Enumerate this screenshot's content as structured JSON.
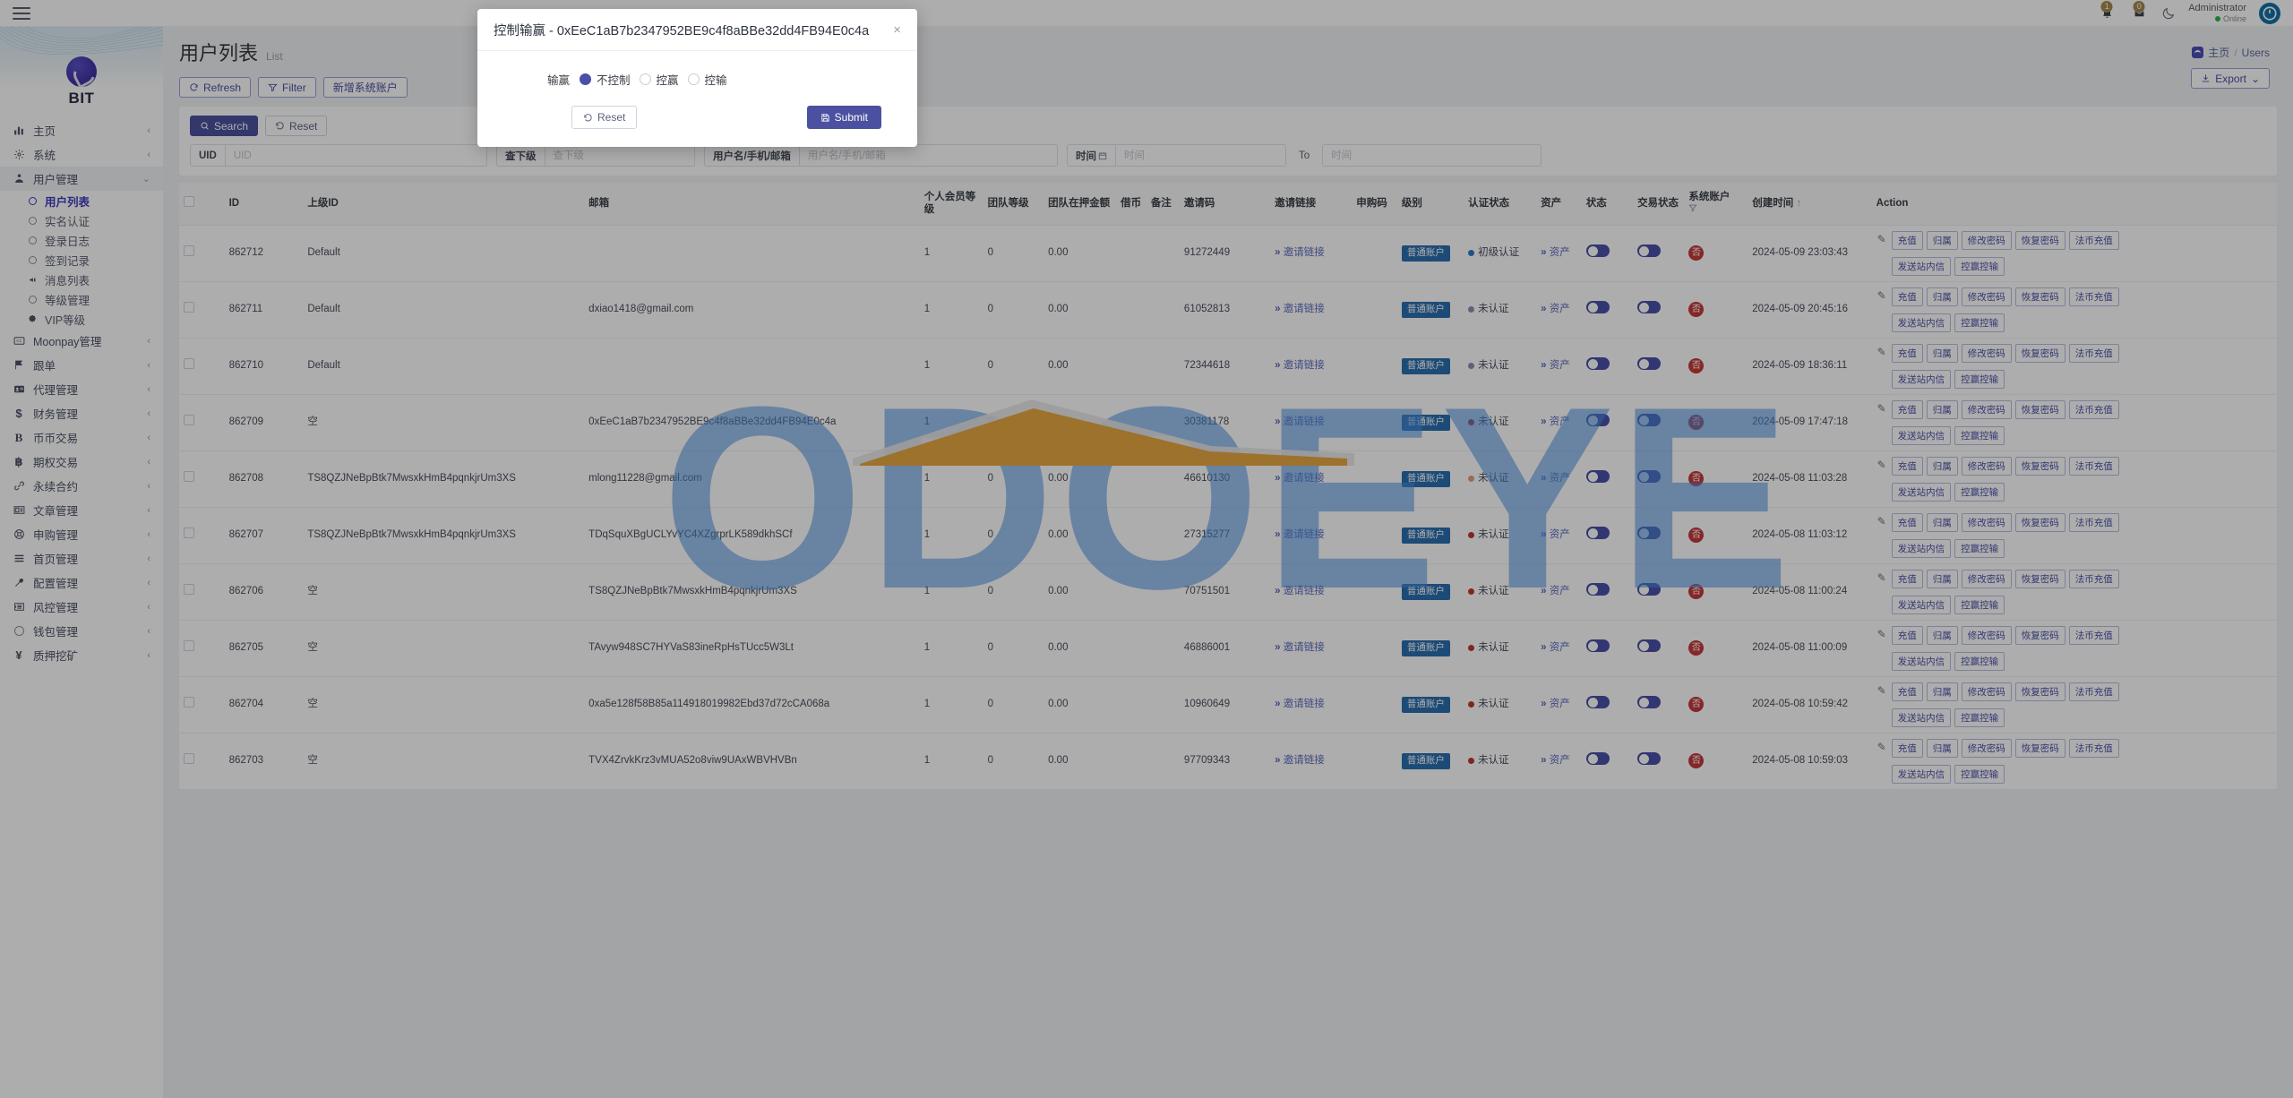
{
  "topbar": {
    "menu_icon": "hamburger-icon",
    "notification_count": "1",
    "message_count": "0",
    "theme_icon": "moon-icon",
    "user_name": "Administrator",
    "user_status": "Online",
    "avatar_icon": "power-icon"
  },
  "sidebar": {
    "brand": "BIT",
    "items": [
      {
        "label": "主页",
        "icon": "chart-icon",
        "arrow": "‹"
      },
      {
        "label": "系统",
        "icon": "gear-icon",
        "arrow": "‹"
      },
      {
        "label": "用户管理",
        "icon": "users-icon",
        "arrow": "⌄",
        "active": true
      }
    ],
    "sub_items": [
      {
        "label": "用户列表",
        "icon": "ring-icon",
        "current": true
      },
      {
        "label": "实名认证",
        "icon": "ring-icon"
      },
      {
        "label": "登录日志",
        "icon": "ring-icon"
      },
      {
        "label": "签到记录",
        "icon": "ring-icon"
      },
      {
        "label": "消息列表",
        "icon": "megaphone-icon"
      },
      {
        "label": "等级管理",
        "icon": "ring-icon"
      },
      {
        "label": "VIP等级",
        "icon": "gear-icon"
      }
    ],
    "items_after": [
      {
        "label": "Moonpay管理",
        "icon": "credit-card-icon",
        "arrow": "‹"
      },
      {
        "label": "跟单",
        "icon": "flag-icon",
        "arrow": "‹"
      },
      {
        "label": "代理管理",
        "icon": "id-card-icon",
        "arrow": "‹"
      },
      {
        "label": "财务管理",
        "icon": "dollar-icon",
        "arrow": "‹"
      },
      {
        "label": "币币交易",
        "icon": "bold-b-icon",
        "arrow": "‹"
      },
      {
        "label": "期权交易",
        "icon": "bitcoin-icon",
        "arrow": "‹"
      },
      {
        "label": "永续合约",
        "icon": "link-icon",
        "arrow": "‹"
      },
      {
        "label": "文章管理",
        "icon": "newspaper-icon",
        "arrow": "‹"
      },
      {
        "label": "申购管理",
        "icon": "lifebuoy-icon",
        "arrow": "‹"
      },
      {
        "label": "首页管理",
        "icon": "list-icon",
        "arrow": "‹"
      },
      {
        "label": "配置管理",
        "icon": "wrench-icon",
        "arrow": "‹"
      },
      {
        "label": "风控管理",
        "icon": "shield-list-icon",
        "arrow": "‹"
      },
      {
        "label": "钱包管理",
        "icon": "ring-icon",
        "arrow": "‹"
      },
      {
        "label": "质押挖矿",
        "icon": "yen-icon",
        "arrow": "‹"
      }
    ]
  },
  "breadcrumb": {
    "home": "主页",
    "sep": "/",
    "current": "Users"
  },
  "page": {
    "title": "用户列表",
    "subtitle": "List",
    "export_label": "Export",
    "export_caret": "⌄"
  },
  "toolbar": {
    "refresh": "Refresh",
    "filter": "Filter",
    "add_system_account": "新增系统账户"
  },
  "search": {
    "search_label": "Search",
    "reset_label": "Reset",
    "fields": [
      {
        "label": "UID",
        "value": "",
        "placeholder": "UID"
      },
      {
        "label": "查下级",
        "value": "",
        "placeholder": "查下级"
      },
      {
        "label": "用户名/手机/邮箱",
        "value": "",
        "placeholder": "用户名/手机/邮箱"
      },
      {
        "label": "时间",
        "value": "",
        "placeholder": "时间"
      }
    ],
    "to_word": "To",
    "time_end_placeholder": "时间"
  },
  "table": {
    "headers": [
      "",
      "ID",
      "上级ID",
      "邮箱",
      "个人会员等级",
      "团队等级",
      "团队在押金额",
      "借币",
      "备注",
      "邀请码",
      "邀请链接",
      "申购码",
      "级别",
      "认证状态",
      "资产",
      "状态",
      "交易状态",
      "系统账户",
      "创建时间",
      "Action"
    ],
    "sort_arrow": "↑",
    "filter_icon": "filter-icon",
    "invite_link_text": "邀请链接",
    "asset_text": "资产",
    "account_tag": "普通账户",
    "no_badge": "否",
    "action_pencil": "pencil-icon",
    "action_buttons_row1": [
      "充值",
      "归属",
      "修改密码",
      "恢复密码",
      "法币充值"
    ],
    "action_buttons_row2": [
      "发送站内信",
      "控赢控输"
    ],
    "rows": [
      {
        "id": "862712",
        "parent": "Default",
        "email": "",
        "member_level": "1",
        "team_level": "0",
        "team_amount": "0.00",
        "coin": "",
        "note": "",
        "invite_code": "91272449",
        "sub_code": "",
        "grade": "",
        "cert": "初级认证",
        "cert_color": "#2b7cc4",
        "created": "2024-05-09 23:03:43"
      },
      {
        "id": "862711",
        "parent": "Default",
        "email": "dxiao1418@gmail.com",
        "member_level": "1",
        "team_level": "0",
        "team_amount": "0.00",
        "coin": "",
        "note": "",
        "invite_code": "61052813",
        "sub_code": "",
        "grade": "",
        "cert": "未认证",
        "cert_color": "#8d8fb5",
        "created": "2024-05-09 20:45:16"
      },
      {
        "id": "862710",
        "parent": "Default",
        "email": "",
        "member_level": "1",
        "team_level": "0",
        "team_amount": "0.00",
        "coin": "",
        "note": "",
        "invite_code": "72344618",
        "sub_code": "",
        "grade": "",
        "cert": "未认证",
        "cert_color": "#8d8fb5",
        "created": "2024-05-09 18:36:11"
      },
      {
        "id": "862709",
        "parent": "空",
        "email": "0xEeC1aB7b2347952BE9c4f8aBBe32dd4FB94E0c4a",
        "member_level": "1",
        "team_level": "0",
        "team_amount": "0.00",
        "coin": "",
        "note": "",
        "invite_code": "30381178",
        "sub_code": "",
        "grade": "",
        "cert": "未认证",
        "cert_color": "#c0392b",
        "created": "2024-05-09 17:47:18"
      },
      {
        "id": "862708",
        "parent": "TS8QZJNeBpBtk7MwsxkHmB4pqnkjrUm3XS",
        "email": "mlong11228@gmail.com",
        "member_level": "1",
        "team_level": "0",
        "team_amount": "0.00",
        "coin": "",
        "note": "",
        "invite_code": "46610130",
        "sub_code": "",
        "grade": "",
        "cert": "未认证",
        "cert_color": "#e2a07a",
        "created": "2024-05-08 11:03:28"
      },
      {
        "id": "862707",
        "parent": "TS8QZJNeBpBtk7MwsxkHmB4pqnkjrUm3XS",
        "email": "TDqSquXBgUCLYvYC4XZgrprLK589dkhSCf",
        "member_level": "1",
        "team_level": "0",
        "team_amount": "0.00",
        "coin": "",
        "note": "",
        "invite_code": "27315277",
        "sub_code": "",
        "grade": "",
        "cert": "未认证",
        "cert_color": "#c0392b",
        "created": "2024-05-08 11:03:12"
      },
      {
        "id": "862706",
        "parent": "空",
        "email": "TS8QZJNeBpBtk7MwsxkHmB4pqnkjrUm3XS",
        "member_level": "1",
        "team_level": "0",
        "team_amount": "0.00",
        "coin": "",
        "note": "",
        "invite_code": "70751501",
        "sub_code": "",
        "grade": "",
        "cert": "未认证",
        "cert_color": "#c0392b",
        "created": "2024-05-08 11:00:24"
      },
      {
        "id": "862705",
        "parent": "空",
        "email": "TAvyw948SC7HYVaS83ineRpHsTUcc5W3Lt",
        "member_level": "1",
        "team_level": "0",
        "team_amount": "0.00",
        "coin": "",
        "note": "",
        "invite_code": "46886001",
        "sub_code": "",
        "grade": "",
        "cert": "未认证",
        "cert_color": "#c0392b",
        "created": "2024-05-08 11:00:09"
      },
      {
        "id": "862704",
        "parent": "空",
        "email": "0xa5e128f58B85a114918019982Ebd37d72cCA068a",
        "member_level": "1",
        "team_level": "0",
        "team_amount": "0.00",
        "coin": "",
        "note": "",
        "invite_code": "10960649",
        "sub_code": "",
        "grade": "",
        "cert": "未认证",
        "cert_color": "#c0392b",
        "created": "2024-05-08 10:59:42"
      },
      {
        "id": "862703",
        "parent": "空",
        "email": "TVX4ZrvkKrz3vMUA52o8viw9UAxWBVHVBn",
        "member_level": "1",
        "team_level": "0",
        "team_amount": "0.00",
        "coin": "",
        "note": "",
        "invite_code": "97709343",
        "sub_code": "",
        "grade": "",
        "cert": "未认证",
        "cert_color": "#c0392b",
        "created": "2024-05-08 10:59:03"
      }
    ]
  },
  "watermark": {
    "text": "ODOEYE"
  },
  "modal": {
    "title": "控制输赢 - 0xEeC1aB7b2347952BE9c4f8aBBe32dd4FB94E0c4a",
    "close": "×",
    "field_label": "输赢",
    "options": [
      {
        "label": "不控制",
        "selected": true
      },
      {
        "label": "控赢",
        "selected": false
      },
      {
        "label": "控输",
        "selected": false
      }
    ],
    "reset_label": "Reset",
    "submit_label": "Submit"
  },
  "colors": {
    "primary": "#4b51a0",
    "link": "#5c6bbf",
    "danger": "#c53a3a",
    "tag": "#2c6fb0",
    "watermark": "#4a90e2"
  }
}
